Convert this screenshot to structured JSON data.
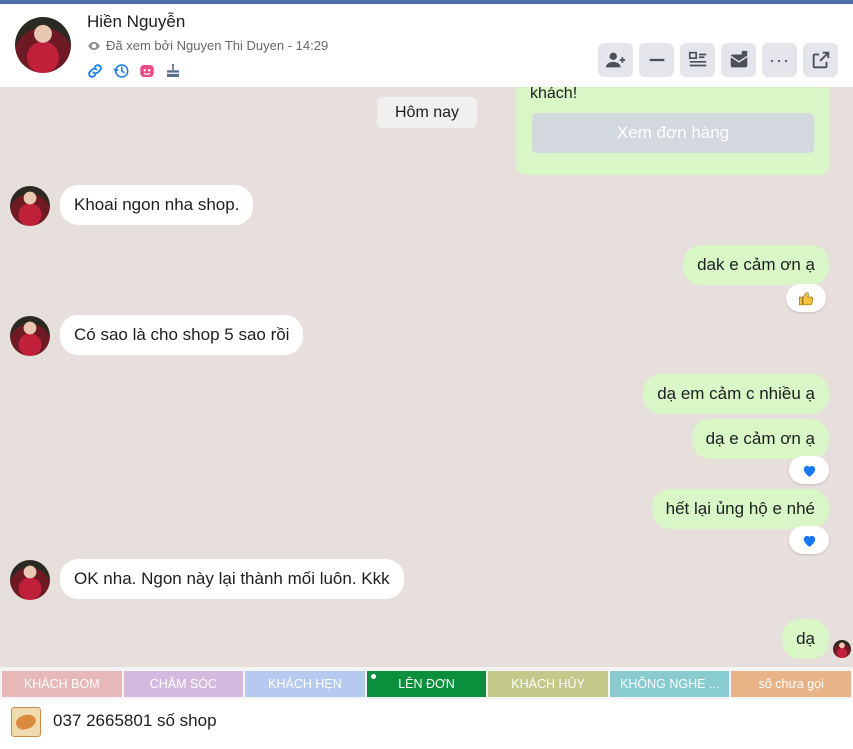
{
  "header": {
    "name": "Hiền Nguyễn",
    "seen_text": "Đã xem bởi Nguyen Thi Duyen - 14:29",
    "tag_icons": [
      "link-icon",
      "history-icon",
      "sticker-icon",
      "cake-icon"
    ],
    "actions": [
      "add-user-icon",
      "minimize-icon",
      "list-icon",
      "mail-icon",
      "more-icon",
      "external-link-icon"
    ],
    "more_label": "···"
  },
  "chat": {
    "order_card_text": "khách!",
    "order_button": "Xem đơn hàng",
    "date_divider": "Hôm nay",
    "messages": [
      {
        "side": "in",
        "text": "Khoai ngon nha shop."
      },
      {
        "side": "out",
        "text": "dak e cảm ơn ạ",
        "reaction": "like"
      },
      {
        "side": "in",
        "text": "Có sao là cho shop 5 sao rồi"
      },
      {
        "side": "out",
        "text": "dạ em cảm c nhiều ạ"
      },
      {
        "side": "out",
        "text": "dạ e cảm ơn ạ",
        "reaction": "heart"
      },
      {
        "side": "out",
        "text": "hết lại ủng hộ e nhé",
        "reaction": "heart"
      },
      {
        "side": "in",
        "text": "OK nha. Ngon này lại thành mối luôn. Kkk"
      },
      {
        "side": "out",
        "text": "dạ"
      }
    ]
  },
  "tags": [
    {
      "label": "KHÁCH BOM",
      "color": "#e6b8b8"
    },
    {
      "label": "CHĂM SÓC",
      "color": "#d5b8e0"
    },
    {
      "label": "KHÁCH HẸN",
      "color": "#b6caf0"
    },
    {
      "label": "LÊN ĐƠN",
      "color": "#0a8f3c"
    },
    {
      "label": "KHÁCH HỦY",
      "color": "#c3c98a"
    },
    {
      "label": "KHÔNG NGHE ...",
      "color": "#88ccd0"
    },
    {
      "label": "số chưa gọi",
      "color": "#e8b387"
    }
  ],
  "footer": {
    "shop_text": "037 2665801 số shop"
  },
  "colors": {
    "accent": "#4a6ea9",
    "chat_bg": "#e7dfdb",
    "outgoing_bubble": "#d9f7c6",
    "incoming_bubble": "#ffffff",
    "reaction_blue": "#1877f2"
  }
}
